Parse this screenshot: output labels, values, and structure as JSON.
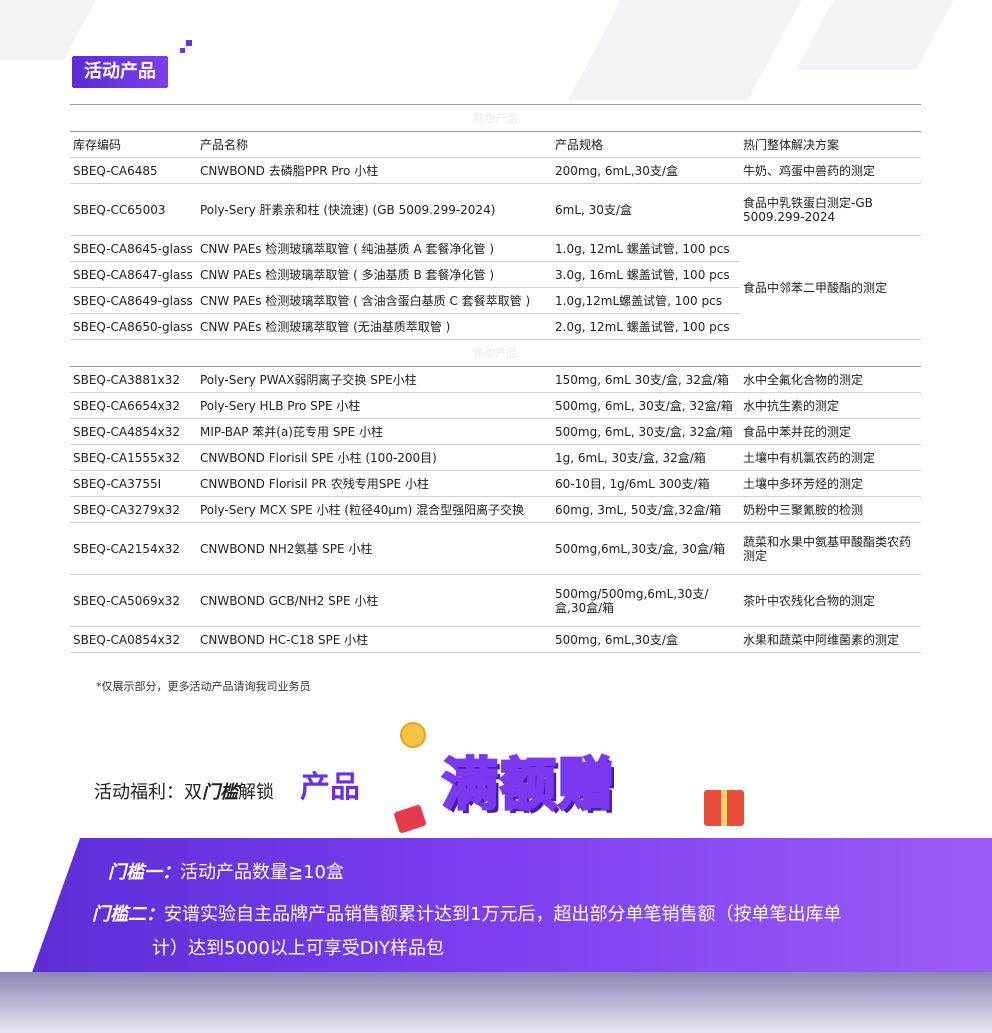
{
  "title": "活动产品",
  "headers": [
    "库存编码",
    "产品名称",
    "产品规格",
    "热门整体解决方案"
  ],
  "section1_label": "特色产品",
  "section2_label": "热卖产品",
  "group1": [
    {
      "code": "SBEQ-CA6485",
      "name": "CNWBOND 去磷脂PPR Pro 小柱",
      "spec": "200mg, 6mL,30支/盒",
      "solution": "牛奶、鸡蛋中兽药的测定"
    },
    {
      "code": "SBEQ-CC65003",
      "name": "Poly-Sery 肝素亲和柱 (快流速) (GB 5009.299-2024)",
      "spec": "6mL, 30支/盒",
      "solution": "食品中乳铁蛋白测定-GB 5009.299-2024"
    }
  ],
  "group2": [
    {
      "code": "SBEQ-CA8645-glass",
      "name": "CNW PAEs 检测玻璃萃取管 ( 纯油基质 A 套餐净化管 )",
      "spec": "1.0g, 12mL 螺盖试管, 100 pcs"
    },
    {
      "code": "SBEQ-CA8647-glass",
      "name": "CNW PAEs 检测玻璃萃取管 ( 多油基质 B 套餐净化管 )",
      "spec": "3.0g, 16mL 螺盖试管, 100 pcs"
    },
    {
      "code": "SBEQ-CA8649-glass",
      "name": "CNW PAEs 检测玻璃萃取管 ( 含油含蛋白基质 C 套餐萃取管 )",
      "spec": "1.0g,12mL螺盖试管, 100 pcs"
    },
    {
      "code": "SBEQ-CA8650-glass",
      "name": "CNW PAEs 检测玻璃萃取管 (无油基质萃取管 )",
      "spec": "2.0g, 12mL 螺盖试管, 100 pcs"
    }
  ],
  "group2_solution": "食品中邻苯二甲酸酯的测定",
  "group3": [
    {
      "code": "SBEQ-CA3881x32",
      "name": "Poly-Sery PWAX弱阴离子交换 SPE小柱",
      "spec": "150mg, 6mL 30支/盒, 32盒/箱",
      "solution": "水中全氟化合物的测定"
    },
    {
      "code": "SBEQ-CA6654x32",
      "name": "Poly-Sery HLB Pro SPE 小柱",
      "spec": "500mg, 6mL, 30支/盒, 32盒/箱",
      "solution": "水中抗生素的测定"
    },
    {
      "code": "SBEQ-CA4854x32",
      "name": "MIP-BAP 苯并(a)芘专用 SPE 小柱",
      "spec": "500mg, 6mL, 30支/盒, 32盒/箱",
      "solution": "食品中苯并芘的测定"
    },
    {
      "code": "SBEQ-CA1555x32",
      "name": "CNWBOND Florisil SPE 小柱 (100-200目)",
      "spec": "1g, 6mL, 30支/盒, 32盒/箱",
      "solution": "土壤中有机氯农药的测定"
    },
    {
      "code": "SBEQ-CA3755I",
      "name": "CNWBOND Florisil PR 农残专用SPE 小柱",
      "spec": "60-10目, 1g/6mL 300支/箱",
      "solution": "土壤中多环芳烃的测定"
    },
    {
      "code": "SBEQ-CA3279x32",
      "name": "Poly-Sery MCX SPE 小柱 (粒径40μm) 混合型强阳离子交换",
      "spec": "60mg, 3mL, 50支/盒,32盒/箱",
      "solution": "奶粉中三聚氰胺的检测"
    },
    {
      "code": "SBEQ-CA2154x32",
      "name": "CNWBOND NH2氨基 SPE 小柱",
      "spec": "500mg,6mL,30支/盒, 30盒/箱",
      "solution": "蔬菜和水果中氨基甲酸酯类农药测定"
    },
    {
      "code": "SBEQ-CA5069x32",
      "name": "CNWBOND GCB/NH2 SPE 小柱",
      "spec": "500mg/500mg,6mL,30支/盒,30盒/箱",
      "solution": "茶叶中农残化合物的测定"
    },
    {
      "code": "SBEQ-CA0854x32",
      "name": "CNWBOND HC-C18 SPE 小柱",
      "spec": "500mg, 6mL,30支/盒",
      "solution": "水果和蔬菜中阿维菌素的测定"
    }
  ],
  "note": "*仅展示部分，更多活动产品请询我司业务员",
  "benefit": {
    "prefix": "活动福利：双",
    "emph": "门槛",
    "suffix": "解锁",
    "product": "产品",
    "badge": "满额赠"
  },
  "threshold1": {
    "label": "门槛一：",
    "text": "活动产品数量≧10盒"
  },
  "threshold2": {
    "label": "门槛二：",
    "text": "安谱实验自主品牌产品销售额累计达到1万元后，超出部分单笔销售额（按单笔出库单",
    "text2": "计）达到5000以上可享受DIY样品包"
  }
}
